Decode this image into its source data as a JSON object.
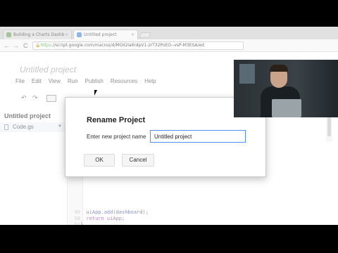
{
  "browser": {
    "tabs": [
      {
        "label": "Building a Charts Dashb",
        "active": false
      },
      {
        "label": "Untitled project",
        "active": true
      }
    ],
    "close_glyph": "×",
    "back_glyph": "←",
    "forward_glyph": "→",
    "reload_glyph": "C",
    "url_scheme": "https",
    "url_rest": "://script.google.com/macros/d/MOXzla6rdpV1-zrT32PoEO--vsP-M3ESA/ed"
  },
  "app": {
    "title": "Untitled project",
    "menu": [
      "File",
      "Edit",
      "View",
      "Run",
      "Publish",
      "Resources",
      "Help"
    ],
    "toolbar": {
      "undo_glyph": "↶",
      "redo_glyph": "↷"
    }
  },
  "sidebar": {
    "project_title": "Untitled project",
    "files": [
      {
        "name": "Code.gs"
      }
    ],
    "file_menu_glyph": "▼"
  },
  "editor": {
    "lines": [
      {
        "num": "49",
        "code": "  uiApp.add(dashboard);"
      },
      {
        "num": "50",
        "code": "  return uiApp;"
      },
      {
        "num": "51",
        "code": "}"
      }
    ]
  },
  "dialog": {
    "title": "Rename Project",
    "close_glyph": "×",
    "label": "Enter new project name",
    "input_value": "Untitled project",
    "ok_label": "OK",
    "cancel_label": "Cancel"
  },
  "colors": {
    "focus_border": "#4d90fe",
    "https_green": "#2a8a2a"
  }
}
